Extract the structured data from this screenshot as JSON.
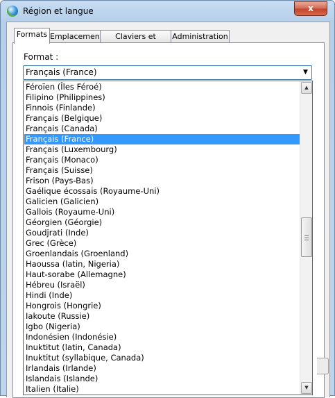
{
  "window": {
    "title": "Région et langue",
    "close_label": "x"
  },
  "tabs": [
    {
      "label": "Formats",
      "active": true
    },
    {
      "label": "Emplacement",
      "active": false
    },
    {
      "label": "Claviers et langues",
      "active": false
    },
    {
      "label": "Administration",
      "active": false
    }
  ],
  "format": {
    "label": "Format :",
    "selected": "Français (France)"
  },
  "dropdown": {
    "items": [
      "Féroïen (Îles Féroé)",
      "Filipino (Philippines)",
      "Finnois (Finlande)",
      "Français (Belgique)",
      "Français (Canada)",
      "Français (France)",
      "Français (Luxembourg)",
      "Français (Monaco)",
      "Français (Suisse)",
      "Frison (Pays-Bas)",
      "Gaélique écossais (Royaume-Uni)",
      "Galicien (Galicien)",
      "Gallois (Royaume-Uni)",
      "Géorgien (Géorgie)",
      "Goudjrati (Inde)",
      "Grec (Grèce)",
      "Groenlandais (Groenland)",
      "Haoussa (latin, Nigeria)",
      "Haut-sorabe (Allemagne)",
      "Hébreu (Israël)",
      "Hindi (Inde)",
      "Hongrois (Hongrie)",
      "Iakoute (Russie)",
      "Igbo (Nigeria)",
      "Indonésien (Indonésie)",
      "Inuktitut (latin, Canada)",
      "Inuktitut (syllabique, Canada)",
      "Irlandais (Irlande)",
      "Islandais (Islande)",
      "Italien (Italie)"
    ],
    "selected_index": 5
  },
  "icons": {
    "combo_arrow": "chevron-down-icon",
    "scroll_up": "scroll-up-arrow-icon",
    "scroll_down": "scroll-down-arrow-icon",
    "title": "globe-icon"
  },
  "colors": {
    "selection": "#3399ff",
    "close_button": "#c7452c"
  }
}
